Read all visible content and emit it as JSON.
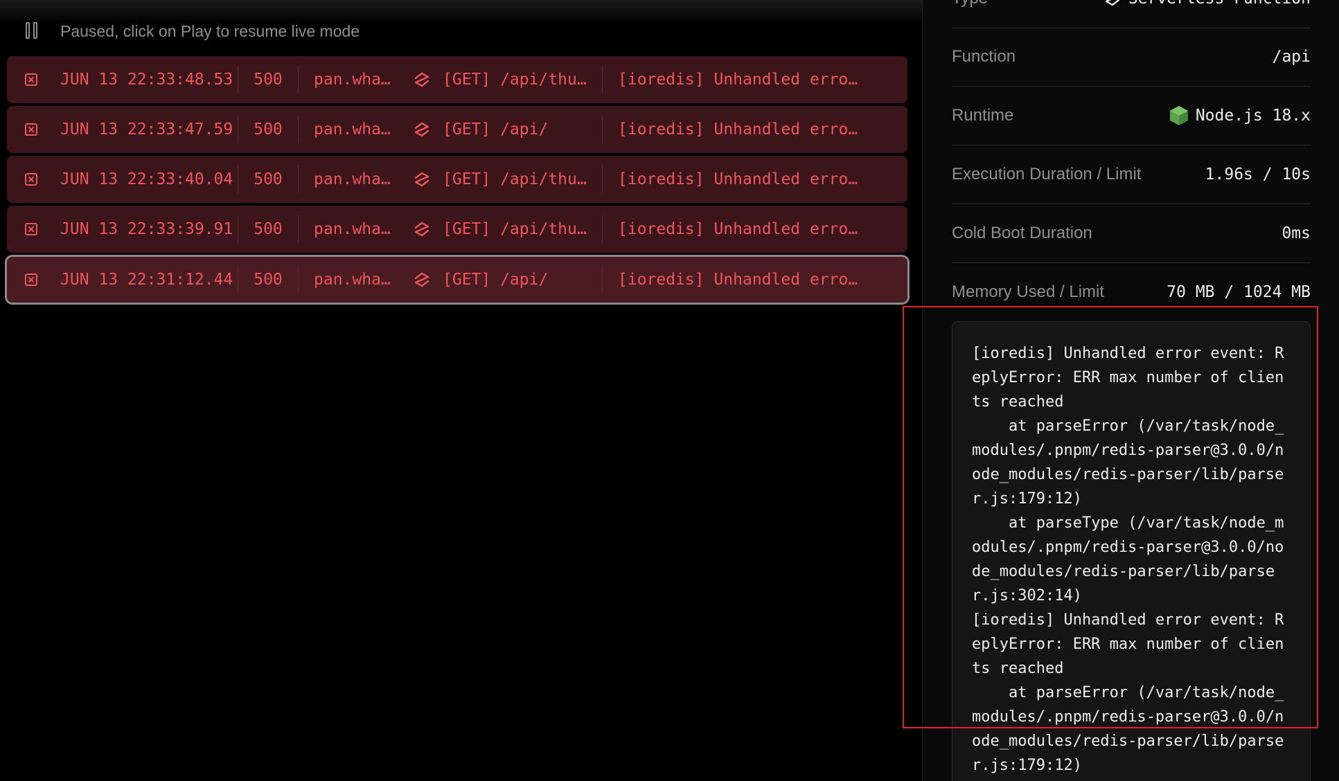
{
  "status_bar": {
    "paused_text": "Paused, click on Play to resume live mode"
  },
  "rows": [
    {
      "time": "JUN 13 22:33:48.53",
      "status": "500",
      "host": "pan.wha…",
      "path": "[GET] /api/thu…",
      "message": "[ioredis] Unhandled erro…"
    },
    {
      "time": "JUN 13 22:33:47.59",
      "status": "500",
      "host": "pan.wha…",
      "path": "[GET] /api/",
      "message": "[ioredis] Unhandled erro…"
    },
    {
      "time": "JUN 13 22:33:40.04",
      "status": "500",
      "host": "pan.wha…",
      "path": "[GET] /api/thu…",
      "message": "[ioredis] Unhandled erro…"
    },
    {
      "time": "JUN 13 22:33:39.91",
      "status": "500",
      "host": "pan.wha…",
      "path": "[GET] /api/thu…",
      "message": "[ioredis] Unhandled erro…"
    },
    {
      "time": "JUN 13 22:31:12.44",
      "status": "500",
      "host": "pan.wha…",
      "path": "[GET] /api/",
      "message": "[ioredis] Unhandled erro…"
    }
  ],
  "details": {
    "type": {
      "label": "Type",
      "value": "Serverless Function"
    },
    "function": {
      "label": "Function",
      "value": "/api"
    },
    "runtime": {
      "label": "Runtime",
      "value": "Node.js 18.x"
    },
    "execution": {
      "label": "Execution Duration / Limit",
      "value": "1.96s / 10s"
    },
    "cold_boot": {
      "label": "Cold Boot Duration",
      "value": "0ms"
    },
    "memory": {
      "label": "Memory Used / Limit",
      "value": "70 MB / 1024 MB"
    }
  },
  "log_output": "[ioredis] Unhandled error event: ReplyError: ERR max number of clients reached\n    at parseError (/var/task/node_modules/.pnpm/redis-parser@3.0.0/node_modules/redis-parser/lib/parser.js:179:12)\n    at parseType (/var/task/node_modules/.pnpm/redis-parser@3.0.0/node_modules/redis-parser/lib/parser.js:302:14)\n[ioredis] Unhandled error event: ReplyError: ERR max number of clients reached\n    at parseError (/var/task/node_modules/.pnpm/redis-parser@3.0.0/node_modules/redis-parser/lib/parser.js:179:12)",
  "colors": {
    "error_text": "#f0555d",
    "row_bg": "#3b1519",
    "highlight": "#e02424"
  },
  "icons": {
    "pause": "pause-icon",
    "row_error": "error-x-icon",
    "function": "serverless-function-icon",
    "runtime": "nodejs-icon"
  }
}
